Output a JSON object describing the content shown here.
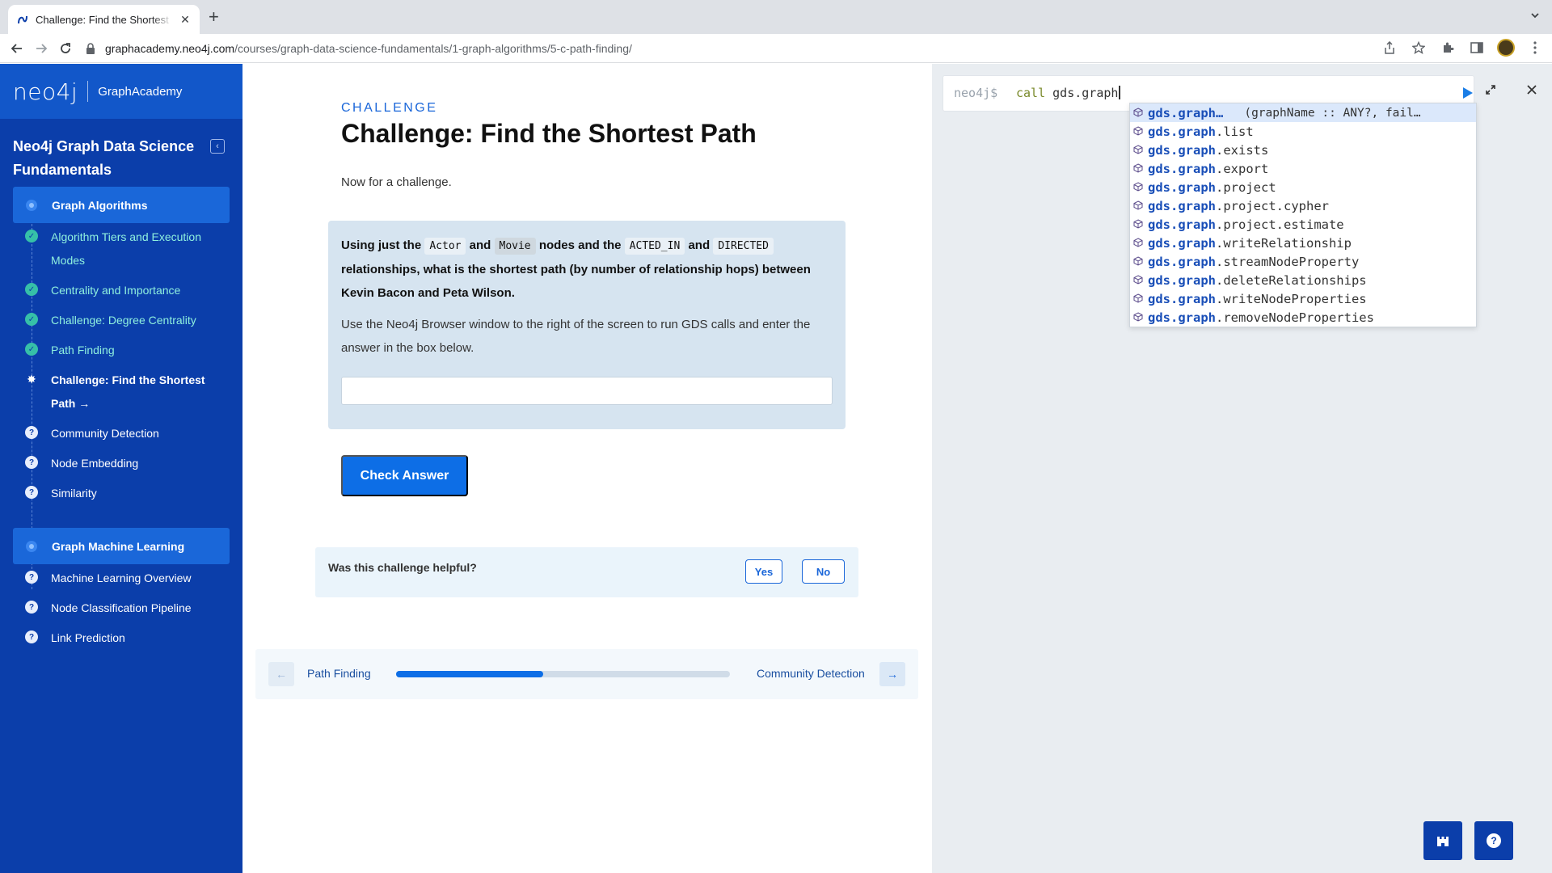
{
  "browser": {
    "tab_title": "Challenge: Find the Shortest Path",
    "url_host": "graphacademy.neo4j.com",
    "url_path": "/courses/graph-data-science-fundamentals/1-graph-algorithms/5-c-path-finding/"
  },
  "sidebar": {
    "logo": "neo4j",
    "brand": "GraphAcademy",
    "course_title": "Neo4j Graph Data Science Fundamentals",
    "module1": {
      "label": "Graph Algorithms",
      "lessons": [
        {
          "label": "Algorithm Tiers and Execution Modes",
          "status": "done"
        },
        {
          "label": "Centrality and Importance",
          "status": "done"
        },
        {
          "label": "Challenge: Degree Centrality",
          "status": "done"
        },
        {
          "label": "Path Finding",
          "status": "done"
        },
        {
          "label": "Challenge: Find the Shortest Path",
          "status": "current"
        },
        {
          "label": "Community Detection",
          "status": "todo"
        },
        {
          "label": "Node Embedding",
          "status": "todo"
        },
        {
          "label": "Similarity",
          "status": "todo"
        }
      ]
    },
    "module2": {
      "label": "Graph Machine Learning",
      "lessons": [
        {
          "label": "Machine Learning Overview",
          "status": "todo"
        },
        {
          "label": "Node Classification Pipeline",
          "status": "todo"
        },
        {
          "label": "Link Prediction",
          "status": "todo"
        }
      ]
    }
  },
  "main": {
    "eyebrow": "CHALLENGE",
    "title": "Challenge: Find the Shortest Path",
    "intro": "Now for a challenge.",
    "question": {
      "p1": "Using just the",
      "code_actor": "Actor",
      "and1": "and",
      "code_movie": "Movie",
      "p2": "nodes and the",
      "code_acted": "ACTED_IN",
      "and2": "and",
      "code_directed": "DIRECTED",
      "p3": "relationships, what is the shortest path (by number of relationship hops) between Kevin Bacon and Peta Wilson.",
      "help": "Use the Neo4j Browser window to the right of the screen to run GDS calls and enter the answer in the box below.",
      "answer_value": ""
    },
    "check_button": "Check Answer",
    "feedback": {
      "question": "Was this challenge helpful?",
      "yes": "Yes",
      "no": "No"
    },
    "pager": {
      "prev": "Path Finding",
      "next": "Community Detection",
      "progress": 0.44
    }
  },
  "browser_panel": {
    "prompt": "neo4j$",
    "keyword": "call",
    "query": "gds.graph",
    "suggestions": [
      {
        "match": "gds.graph",
        "rest": "…",
        "sig": "(graphName :: ANY?, fail…",
        "selected": true
      },
      {
        "match": "gds.graph",
        "rest": ".list"
      },
      {
        "match": "gds.graph",
        "rest": ".exists"
      },
      {
        "match": "gds.graph",
        "rest": ".export"
      },
      {
        "match": "gds.graph",
        "rest": ".project"
      },
      {
        "match": "gds.graph",
        "rest": ".project.cypher"
      },
      {
        "match": "gds.graph",
        "rest": ".project.estimate"
      },
      {
        "match": "gds.graph",
        "rest": ".writeRelationship"
      },
      {
        "match": "gds.graph",
        "rest": ".streamNodeProperty"
      },
      {
        "match": "gds.graph",
        "rest": ".deleteRelationships"
      },
      {
        "match": "gds.graph",
        "rest": ".writeNodeProperties"
      },
      {
        "match": "gds.graph",
        "rest": ".removeNodeProperties"
      }
    ]
  },
  "colors": {
    "sidebar_bg": "#0b3eaa",
    "accent": "#0d6ee6",
    "done_green": "#36c0a8"
  }
}
